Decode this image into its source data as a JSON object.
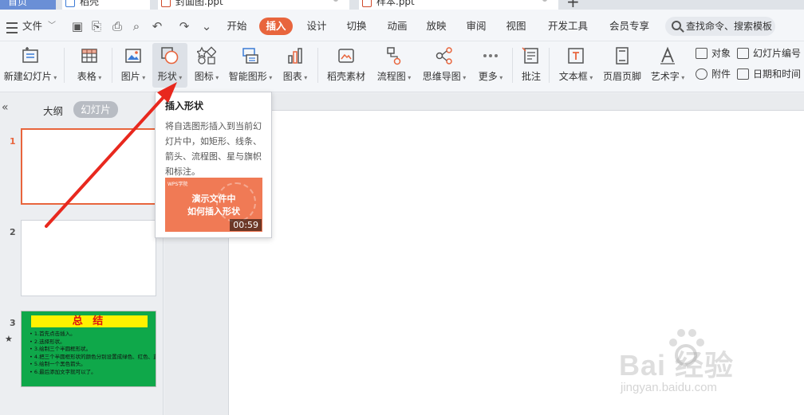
{
  "tabs": {
    "home": "首页",
    "doc1": "稻壳",
    "doc2": "封面图.ppt",
    "doc3": "样本.ppt"
  },
  "menubar": {
    "file": "文件",
    "tabs": [
      "开始",
      "插入",
      "设计",
      "切换",
      "动画",
      "放映",
      "审阅",
      "视图",
      "开发工具",
      "会员专享"
    ],
    "active_tab": "插入",
    "search_placeholder": "查找命令、搜索模板"
  },
  "ribbon": {
    "new_slide": "新建幻灯片",
    "table": "表格",
    "picture": "图片",
    "shape": "形状",
    "icon": "图标",
    "smartart": "智能图形",
    "chart": "图表",
    "docer": "稻壳素材",
    "flowchart": "流程图",
    "mindmap": "思维导图",
    "more": "更多",
    "comment": "批注",
    "textbox": "文本框",
    "header_footer": "页眉页脚",
    "wordart": "艺术字",
    "object": "对象",
    "slide_number": "幻灯片编号",
    "attachment": "附件",
    "datetime": "日期和时间"
  },
  "leftpanel": {
    "outline": "大纲",
    "slides": "幻灯片",
    "slide_numbers": [
      "1",
      "2",
      "3"
    ],
    "slide3_title": "总 结",
    "slide3_items": [
      "• 1.首先点击插入。",
      "• 2.选择形状。",
      "• 3.绘制三个半圆框形状。",
      "• 4.把三个半圆框形状的颜色分别设置成绿色、红色、蓝色。",
      "• 5.绘制一个黑色箭头。",
      "• 6.最后添加文字就可以了。"
    ]
  },
  "tooltip": {
    "title": "插入形状",
    "description": "将自选图形插入到当前幻灯片中，如矩形、线条、箭头、流程图、星与旗帜和标注。",
    "video_title_line1": "演示文件中",
    "video_title_line2": "如何插入形状",
    "duration": "00:59",
    "logo": "WPS学院"
  },
  "watermark": {
    "text": "Bai 经验",
    "sub": "jingyan.baidu.com"
  },
  "colors": {
    "accent": "#e8653d",
    "arrow": "#e8281e",
    "slide3_bg": "#0fa84a",
    "slide3_title_bg": "#fff200",
    "slide3_title_text": "#e01010"
  }
}
